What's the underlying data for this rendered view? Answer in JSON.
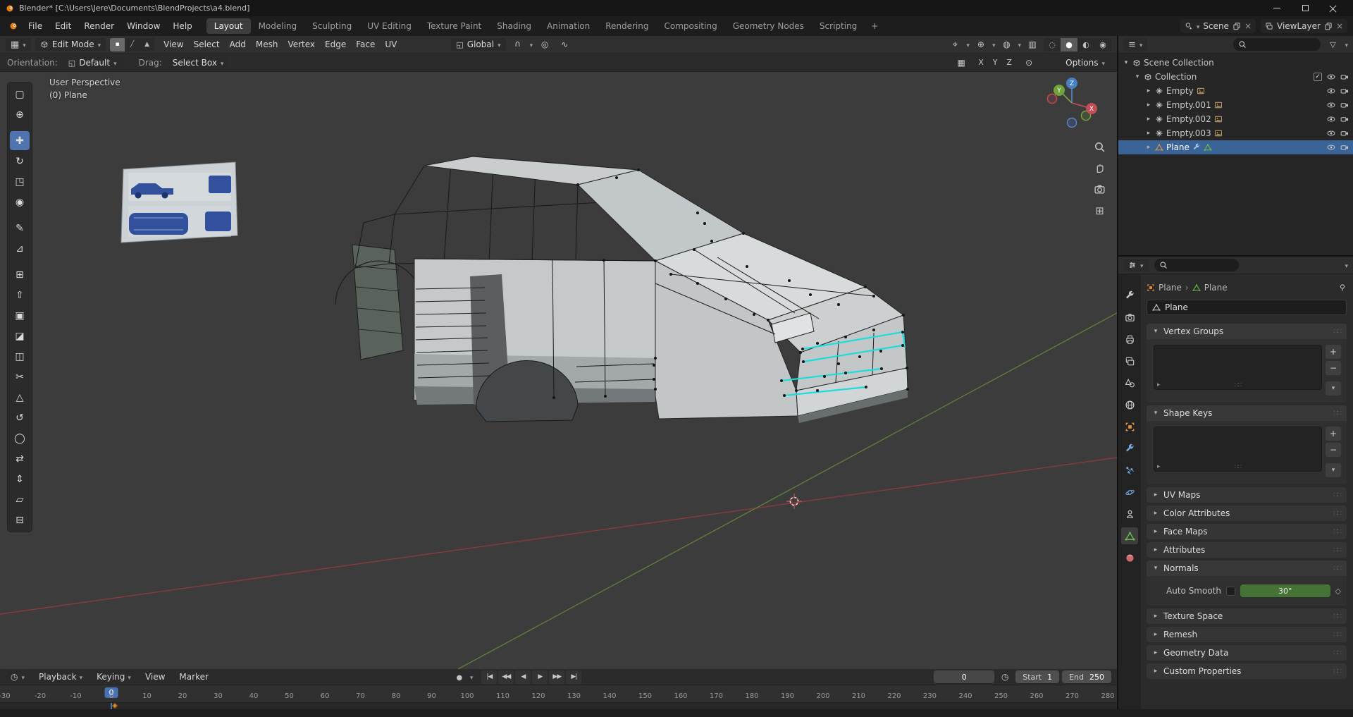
{
  "titlebar": {
    "title": "Blender* [C:\\Users\\Jere\\Documents\\BlendProjects\\a4.blend]"
  },
  "menubar": {
    "menus": [
      "File",
      "Edit",
      "Render",
      "Window",
      "Help"
    ],
    "workspaces": [
      {
        "label": "Layout",
        "active": true
      },
      {
        "label": "Modeling"
      },
      {
        "label": "Sculpting"
      },
      {
        "label": "UV Editing"
      },
      {
        "label": "Texture Paint"
      },
      {
        "label": "Shading"
      },
      {
        "label": "Animation"
      },
      {
        "label": "Rendering"
      },
      {
        "label": "Compositing"
      },
      {
        "label": "Geometry Nodes"
      },
      {
        "label": "Scripting"
      }
    ],
    "add_tab": "+",
    "scene_selector": {
      "label": "Scene"
    },
    "view_layer_selector": {
      "label": "ViewLayer"
    }
  },
  "viewport": {
    "header": {
      "mode": "Edit Mode",
      "select_modes": [
        {
          "name": "vertex-select-mode",
          "glyph": "▪",
          "active": true
        },
        {
          "name": "edge-select-mode",
          "glyph": "╱"
        },
        {
          "name": "face-select-mode",
          "glyph": "▲"
        }
      ],
      "menus": [
        "View",
        "Select",
        "Add",
        "Mesh",
        "Vertex",
        "Edge",
        "Face",
        "UV"
      ],
      "orientation": "Global"
    },
    "tool_settings": {
      "orientation_label": "Orientation:",
      "orientation_value": "Default",
      "drag_label": "Drag:",
      "drag_value": "Select Box",
      "mirror_axes": [
        "X",
        "Y",
        "Z"
      ],
      "options_label": "Options"
    },
    "overlay": {
      "line1": "User Perspective",
      "line2": "(0) Plane"
    },
    "gizmo": {
      "x": "X",
      "y": "Y",
      "z": "Z"
    }
  },
  "toolbar": {
    "tools": [
      {
        "name": "select-box",
        "glyph": "▢"
      },
      {
        "name": "cursor",
        "glyph": "⊕"
      },
      {
        "name": "move",
        "glyph": "✚",
        "active": true
      },
      {
        "name": "rotate",
        "glyph": "↻"
      },
      {
        "name": "scale",
        "glyph": "◳"
      },
      {
        "name": "transform",
        "glyph": "◉"
      },
      {
        "name": "annotate",
        "glyph": "✎"
      },
      {
        "name": "measure",
        "glyph": "⊿"
      },
      {
        "name": "add-cube",
        "glyph": "⊞"
      },
      {
        "name": "extrude-region",
        "glyph": "⇧"
      },
      {
        "name": "inset-faces",
        "glyph": "▣"
      },
      {
        "name": "bevel",
        "glyph": "◪"
      },
      {
        "name": "loop-cut",
        "glyph": "◫"
      },
      {
        "name": "knife",
        "glyph": "✂"
      },
      {
        "name": "poly-build",
        "glyph": "△"
      },
      {
        "name": "spin",
        "glyph": "↺"
      },
      {
        "name": "smooth",
        "glyph": "◯"
      },
      {
        "name": "edge-slide",
        "glyph": "⇄"
      },
      {
        "name": "shrink-fatten",
        "glyph": "⇕"
      },
      {
        "name": "shear",
        "glyph": "▱"
      },
      {
        "name": "rip-region",
        "glyph": "⊟"
      }
    ]
  },
  "outliner": {
    "rows": [
      {
        "label": "Scene Collection"
      },
      {
        "label": "Collection"
      },
      {
        "label": "Empty"
      },
      {
        "label": "Empty.001"
      },
      {
        "label": "Empty.002"
      },
      {
        "label": "Empty.003"
      },
      {
        "label": "Plane"
      }
    ]
  },
  "properties": {
    "breadcrumb": {
      "object": "Plane",
      "separator": "›",
      "data": "Plane"
    },
    "name_value": "Plane",
    "sections": {
      "vertex_groups": "Vertex Groups",
      "shape_keys": "Shape Keys",
      "uv_maps": "UV Maps",
      "color_attributes": "Color Attributes",
      "face_maps": "Face Maps",
      "attributes": "Attributes",
      "normals": "Normals",
      "auto_smooth_label": "Auto Smooth",
      "auto_smooth_value": "30°",
      "texture_space": "Texture Space",
      "remesh": "Remesh",
      "geometry_data": "Geometry Data",
      "custom_properties": "Custom Properties"
    }
  },
  "timeline": {
    "menus": [
      {
        "label": "Playback",
        "caret": true
      },
      {
        "label": "Keying",
        "caret": true
      },
      {
        "label": "View"
      },
      {
        "label": "Marker"
      }
    ],
    "transport": [
      {
        "name": "jump-to-start",
        "glyph": "|◀"
      },
      {
        "name": "jump-to-prev-keyframe",
        "glyph": "◀◀"
      },
      {
        "name": "play-reverse",
        "glyph": "◀"
      },
      {
        "name": "play",
        "glyph": "▶"
      },
      {
        "name": "jump-to-next-keyframe",
        "glyph": "▶▶"
      },
      {
        "name": "jump-to-end",
        "glyph": "▶|"
      }
    ],
    "current_frame": "0",
    "start_label": "Start",
    "start_value": "1",
    "end_label": "End",
    "end_value": "250",
    "ruler": [
      "-30",
      "-20",
      "-10",
      "0",
      "10",
      "20",
      "30",
      "40",
      "50",
      "60",
      "70",
      "80",
      "90",
      "100",
      "110",
      "120",
      "130",
      "140",
      "150",
      "160",
      "170",
      "180",
      "190",
      "200",
      "210",
      "220",
      "230",
      "240",
      "250",
      "260",
      "270",
      "280"
    ]
  }
}
